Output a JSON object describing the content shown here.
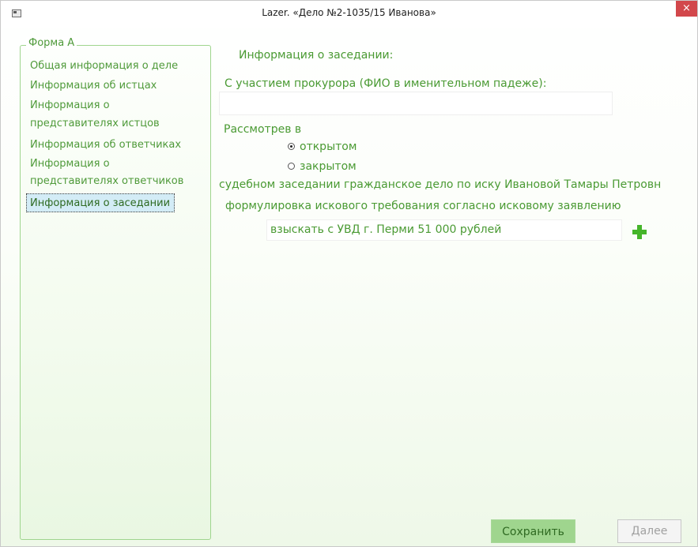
{
  "window": {
    "title": "Lazer. «Дело №2-1035/15 Иванова»",
    "close_glyph": "×"
  },
  "sidebar": {
    "legend": "Форма А",
    "items": [
      {
        "label": "Общая информация о деле"
      },
      {
        "label": "Информация об истцах"
      },
      {
        "label": "Информация о"
      },
      {
        "label": "представителях истцов"
      },
      {
        "label": "Информация об ответчиках"
      },
      {
        "label": "Информация о"
      },
      {
        "label": "представителях ответчиков"
      },
      {
        "label": "Информация о заседании",
        "selected": true
      }
    ]
  },
  "main": {
    "section_title": "Информация о заседании:",
    "prosecutor_label": "С участием прокурора (ФИО в именительном падеже):",
    "prosecutor_value": "",
    "considered_label": "Рассмотрев в",
    "radio_options": [
      {
        "label": "открытом",
        "checked": true
      },
      {
        "label": "закрытом",
        "checked": false
      }
    ],
    "case_text": "судебном заседании гражданское дело по иску Ивановой Тамары Петровн",
    "claim_label": "формулировка искового требования согласно исковому заявлению",
    "claim_value": "взыскать с УВД г. Перми 51 000 рублей"
  },
  "footer": {
    "save_label": "Сохранить",
    "next_label": "Далее"
  },
  "colors": {
    "accent_green": "#4a9a33",
    "button_green": "#9fd58e",
    "selection_blue": "#d3ecf6",
    "close_red": "#d2474b"
  },
  "icons": {
    "app": "window-icon",
    "close": "close-icon",
    "add": "plus-icon"
  }
}
